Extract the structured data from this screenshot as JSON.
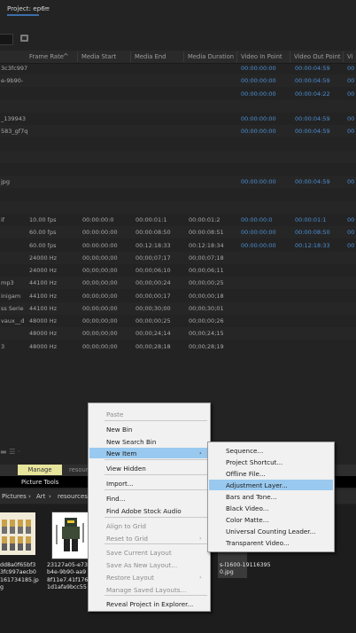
{
  "panel": {
    "project_tab": "Project: ep6",
    "tab_menu_glyph": "≡"
  },
  "columns": [
    "Frame Rate",
    "Media Start",
    "Media End",
    "Media Duration",
    "Video In Point",
    "Video Out Point",
    "Vi"
  ],
  "sort_indicator": "^",
  "rows": [
    {
      "name": "3c3fc997",
      "fr": "",
      "ms": "",
      "me": "",
      "md": "",
      "vin": "00:00:00:00",
      "vout": "00:00:04:59",
      "vi": "00"
    },
    {
      "name": "e-9b90-",
      "fr": "",
      "ms": "",
      "me": "",
      "md": "",
      "vin": "00:00:00:00",
      "vout": "00:00:04:59",
      "vi": "00"
    },
    {
      "name": "",
      "fr": "",
      "ms": "",
      "me": "",
      "md": "",
      "vin": "00:00:00:00",
      "vout": "00:00:04:22",
      "vi": "00"
    },
    {
      "name": "",
      "fr": "",
      "ms": "",
      "me": "",
      "md": "",
      "vin": "",
      "vout": "",
      "vi": ""
    },
    {
      "name": "_139943",
      "fr": "",
      "ms": "",
      "me": "",
      "md": "",
      "vin": "00:00:00:00",
      "vout": "00:00:04:59",
      "vi": "00"
    },
    {
      "name": "583_gf7q",
      "fr": "",
      "ms": "",
      "me": "",
      "md": "",
      "vin": "00:00:00:00",
      "vout": "00:00:04:59",
      "vi": "00"
    },
    {
      "name": "",
      "fr": "",
      "ms": "",
      "me": "",
      "md": "",
      "vin": "",
      "vout": "",
      "vi": ""
    },
    {
      "name": "",
      "fr": "",
      "ms": "",
      "me": "",
      "md": "",
      "vin": "",
      "vout": "",
      "vi": ""
    },
    {
      "name": "",
      "fr": "",
      "ms": "",
      "me": "",
      "md": "",
      "vin": "",
      "vout": "",
      "vi": ""
    },
    {
      "name": "jpg",
      "fr": "",
      "ms": "",
      "me": "",
      "md": "",
      "vin": "00:00:00:00",
      "vout": "00:00:04:59",
      "vi": "00"
    },
    {
      "name": "",
      "fr": "",
      "ms": "",
      "me": "",
      "md": "",
      "vin": "",
      "vout": "",
      "vi": ""
    },
    {
      "name": "",
      "fr": "",
      "ms": "",
      "me": "",
      "md": "",
      "vin": "",
      "vout": "",
      "vi": ""
    },
    {
      "name": "if",
      "fr": "10.00 fps",
      "ms": "00:00:00:0",
      "me": "00:00:01:1",
      "md": "00:00:01:2",
      "vin": "00:00:00:0",
      "vout": "00:00:01:1",
      "vi": "00"
    },
    {
      "name": "",
      "fr": "60.00 fps",
      "ms": "00:00:00:00",
      "me": "00:00:08:50",
      "md": "00:00:08:51",
      "vin": "00:00:00:00",
      "vout": "00:00:08:50",
      "vi": "00"
    },
    {
      "name": "",
      "fr": "60.00 fps",
      "ms": "00:00:00:00",
      "me": "00:12:18:33",
      "md": "00:12:18:34",
      "vin": "00:00:00:00",
      "vout": "00:12:18:33",
      "vi": "00"
    },
    {
      "name": "",
      "fr": "24000 Hz",
      "ms": "00;00;00;00",
      "me": "00;00;07;17",
      "md": "00;00;07;18",
      "vin": "",
      "vout": "",
      "vi": ""
    },
    {
      "name": "",
      "fr": "24000 Hz",
      "ms": "00;00;00;00",
      "me": "00;00;06;10",
      "md": "00;00;06;11",
      "vin": "",
      "vout": "",
      "vi": ""
    },
    {
      "name": "mp3",
      "fr": "44100 Hz",
      "ms": "00;00;00;00",
      "me": "00;00;00;24",
      "md": "00;00;00;25",
      "vin": "",
      "vout": "",
      "vi": ""
    },
    {
      "name": "inigam",
      "fr": "44100 Hz",
      "ms": "00;00;00;00",
      "me": "00;00;00;17",
      "md": "00;00;00;18",
      "vin": "",
      "vout": "",
      "vi": ""
    },
    {
      "name": "ss Serie",
      "fr": "44100 Hz",
      "ms": "00;00;00;00",
      "me": "00;00;30;00",
      "md": "00;00;30;01",
      "vin": "",
      "vout": "",
      "vi": ""
    },
    {
      "name": "vaux__d",
      "fr": "48000 Hz",
      "ms": "00;00;00;00",
      "me": "00;00;00;25",
      "md": "00;00;00;26",
      "vin": "",
      "vout": "",
      "vi": ""
    },
    {
      "name": "",
      "fr": "48000 Hz",
      "ms": "00;00;00;00",
      "me": "00;00;24;14",
      "md": "00;00;24;15",
      "vin": "",
      "vout": "",
      "vi": ""
    },
    {
      "name": "3",
      "fr": "48000 Hz",
      "ms": "00;00;00;00",
      "me": "00;00;28;18",
      "md": "00;00;28;19",
      "vin": "",
      "vout": "",
      "vi": ""
    }
  ],
  "explorer": {
    "ribbon_tab_manage": "Manage",
    "ribbon_tab_resources": "resour",
    "picture_tools": "Picture Tools",
    "breadcrumbs": [
      "Pictures",
      "Art",
      "resources"
    ],
    "crumb_sep": "›",
    "file1": "dd8a0f65bf3\n3fc997aecb0\n161734185.jp\ng",
    "file2": "23127a05-e73b\nb4e-9b90-aa9\n8f11e7.41f176\n1d1afa9bcc55",
    "file3": "s-l1600-19116395\n0.jpg"
  },
  "context_menu": {
    "items": [
      {
        "label": "Paste",
        "enabled": false
      },
      {
        "label": "New Bin",
        "enabled": true
      },
      {
        "label": "New Search Bin",
        "enabled": true
      },
      {
        "label": "New Item",
        "enabled": true,
        "submenu": true,
        "highlighted": true
      },
      {
        "label": "View Hidden",
        "enabled": true
      },
      {
        "label": "Import...",
        "enabled": true
      },
      {
        "label": "Find...",
        "enabled": true
      },
      {
        "label": "Find Adobe Stock Audio",
        "enabled": true
      },
      {
        "label": "Align to Grid",
        "enabled": false
      },
      {
        "label": "Reset to Grid",
        "enabled": false,
        "submenu": true
      },
      {
        "label": "Save Current Layout",
        "enabled": false
      },
      {
        "label": "Save As New Layout...",
        "enabled": false
      },
      {
        "label": "Restore Layout",
        "enabled": false,
        "submenu": true
      },
      {
        "label": "Manage Saved Layouts...",
        "enabled": false
      },
      {
        "label": "Reveal Project in Explorer...",
        "enabled": true
      }
    ],
    "submenu_arrow": "›"
  },
  "submenu": {
    "items": [
      {
        "label": "Sequence..."
      },
      {
        "label": "Project Shortcut..."
      },
      {
        "label": "Offline File..."
      },
      {
        "label": "Adjustment Layer...",
        "highlighted": true
      },
      {
        "label": "Bars and Tone..."
      },
      {
        "label": "Black Video..."
      },
      {
        "label": "Color Matte..."
      },
      {
        "label": "Universal Counting Leader..."
      },
      {
        "label": "Transparent Video..."
      }
    ]
  },
  "colors": {
    "timecode_blue": "#4c8fd3",
    "menu_highlight": "#99c9ef",
    "manage_tab": "#e7e49c"
  }
}
